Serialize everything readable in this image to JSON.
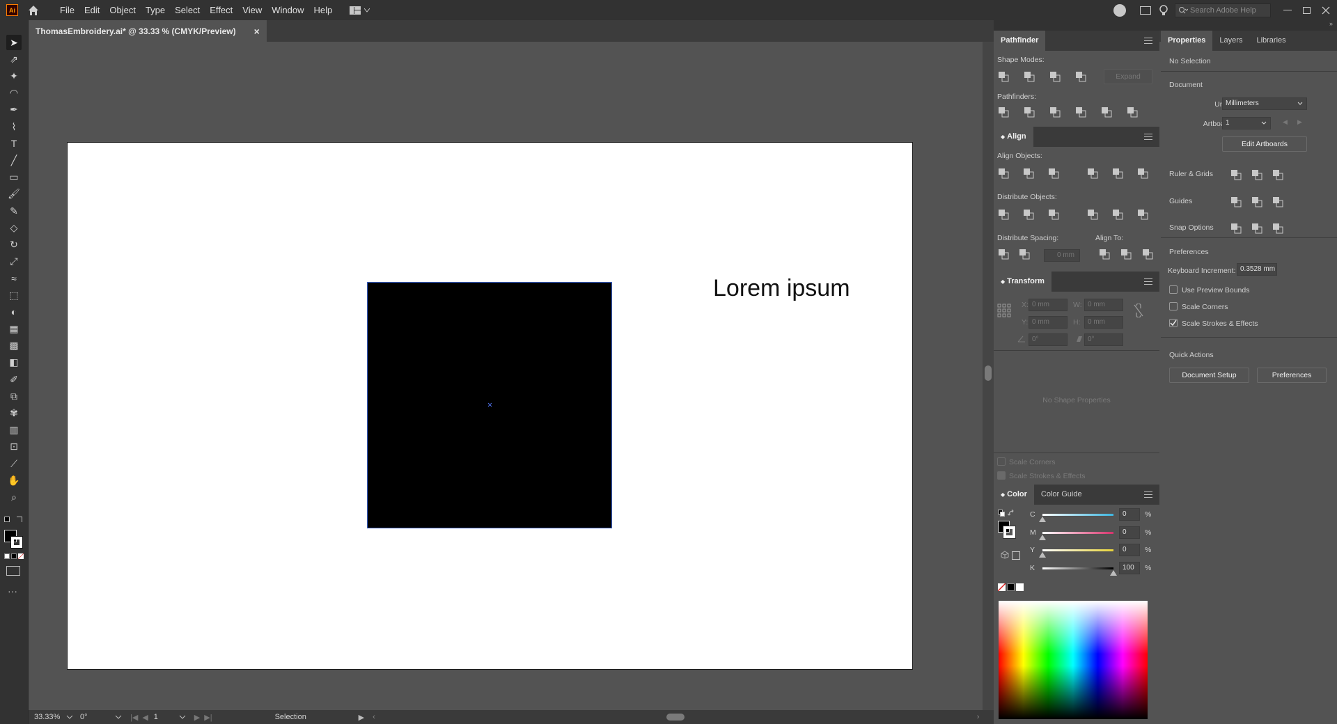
{
  "app": {
    "logo": "Ai"
  },
  "menu": [
    "File",
    "Edit",
    "Object",
    "Type",
    "Select",
    "Effect",
    "View",
    "Window",
    "Help"
  ],
  "search": {
    "placeholder": "Search Adobe Help"
  },
  "document_tab": {
    "title": "ThomasEmbroidery.ai* @ 33.33 % (CMYK/Preview)",
    "close": "×"
  },
  "canvas": {
    "text": "Lorem ipsum"
  },
  "status": {
    "zoom": "33.33%",
    "rotation": "0°",
    "artboard": "1",
    "tool": "Selection"
  },
  "pathfinder": {
    "tab": "Pathfinder",
    "shape_modes": "Shape Modes:",
    "expand": "Expand",
    "pathfinders": "Pathfinders:"
  },
  "align": {
    "tab": "Align",
    "align_objects": "Align Objects:",
    "distribute_objects": "Distribute Objects:",
    "distribute_spacing": "Distribute Spacing:",
    "spacing_value": "0 mm",
    "align_to": "Align To:"
  },
  "transform": {
    "tab": "Transform",
    "x_label": "X:",
    "x_value": "0 mm",
    "y_label": "Y:",
    "y_value": "0 mm",
    "w_label": "W:",
    "w_value": "0 mm",
    "h_label": "H:",
    "h_value": "0 mm",
    "angle_value": "0°",
    "shear_value": "0°",
    "no_shape": "No Shape Properties",
    "scale_corners": "Scale Corners",
    "scale_strokes": "Scale Strokes & Effects"
  },
  "color": {
    "tabs": [
      "Color",
      "Color Guide"
    ],
    "channels": [
      {
        "name": "C",
        "value": "0",
        "unit": "%",
        "fraction": 0.0
      },
      {
        "name": "M",
        "value": "0",
        "unit": "%",
        "fraction": 0.0
      },
      {
        "name": "Y",
        "value": "0",
        "unit": "%",
        "fraction": 0.0
      },
      {
        "name": "K",
        "value": "100",
        "unit": "%",
        "fraction": 1.0
      }
    ],
    "channel_colors": [
      "#3db6e0",
      "#d6336c",
      "#e6d23a",
      "#e8e8e8"
    ]
  },
  "properties": {
    "tabs": [
      "Properties",
      "Layers",
      "Libraries"
    ],
    "no_selection": "No Selection",
    "document": "Document",
    "units_label": "Units:",
    "units_value": "Millimeters",
    "artboard_label": "Artboard:",
    "artboard_value": "1",
    "edit_artboards": "Edit Artboards",
    "ruler_grids": "Ruler & Grids",
    "guides": "Guides",
    "snap_options": "Snap Options",
    "preferences_header": "Preferences",
    "keyboard_increment_label": "Keyboard Increment:",
    "keyboard_increment_value": "0.3528 mm",
    "use_preview_bounds": "Use Preview Bounds",
    "scale_corners": "Scale Corners",
    "scale_strokes": "Scale Strokes & Effects",
    "quick_actions": "Quick Actions",
    "document_setup": "Document Setup",
    "preferences_button": "Preferences"
  }
}
